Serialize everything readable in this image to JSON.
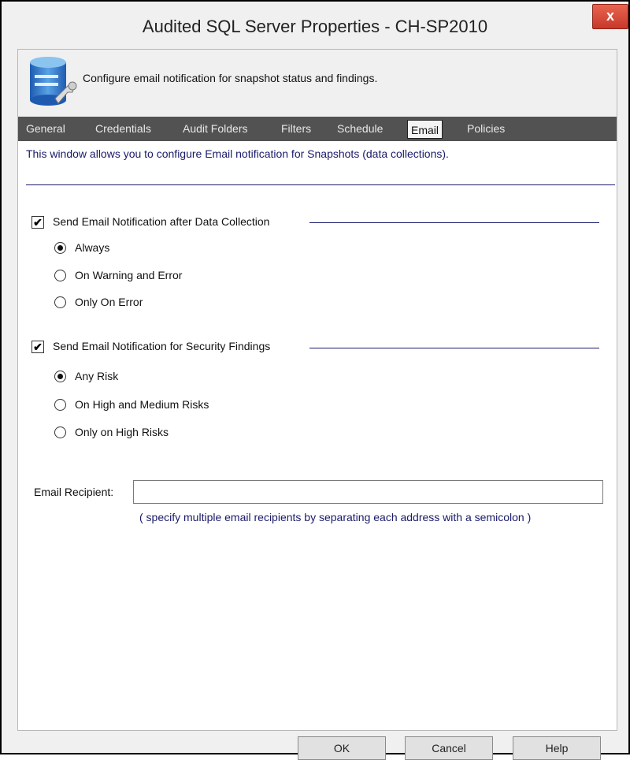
{
  "window": {
    "title": "Audited SQL Server Properties - CH-SP2010",
    "close_label": "x"
  },
  "header": {
    "icon": "database-wrench-icon",
    "text": "Configure email notification for snapshot status and findings."
  },
  "tabs": [
    {
      "label": "General"
    },
    {
      "label": "Credentials"
    },
    {
      "label": "Audit Folders"
    },
    {
      "label": "Filters"
    },
    {
      "label": "Schedule"
    },
    {
      "label": "Email",
      "active": true
    },
    {
      "label": "Policies"
    }
  ],
  "description": "This window allows you to configure Email notification for Snapshots (data collections).",
  "collection_group": {
    "label": "Send Email Notification after Data Collection",
    "checked": true,
    "options": [
      {
        "label": "Always",
        "selected": true
      },
      {
        "label": "On Warning and Error",
        "selected": false
      },
      {
        "label": "Only On Error",
        "selected": false
      }
    ]
  },
  "findings_group": {
    "label": "Send Email Notification for Security Findings",
    "checked": true,
    "options": [
      {
        "label": "Any Risk",
        "selected": true
      },
      {
        "label": "On High and Medium Risks",
        "selected": false
      },
      {
        "label": "Only on High Risks",
        "selected": false
      }
    ]
  },
  "email": {
    "label": "Email Recipient:",
    "value": "",
    "hint": "( specify multiple email recipients by separating each address with a semicolon )"
  },
  "buttons": {
    "ok": "OK",
    "cancel": "Cancel",
    "help": "Help"
  },
  "colors": {
    "tab_bar": "#525252",
    "accent_text": "#1a1a6a",
    "close_button": "#c8382a"
  }
}
